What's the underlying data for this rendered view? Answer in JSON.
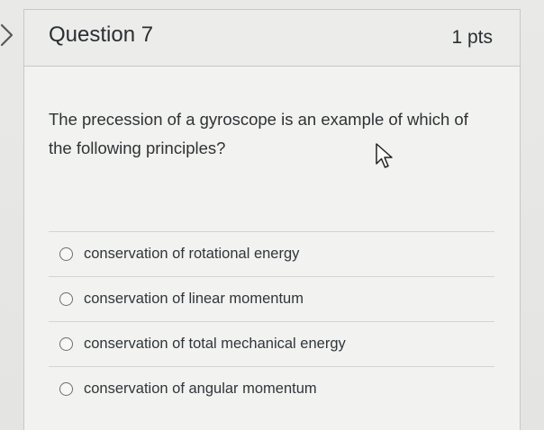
{
  "question": {
    "title": "Question 7",
    "points": "1 pts",
    "text": "The precession of a gyroscope is an example of which of the following principles?"
  },
  "answers": [
    {
      "label": "conservation of rotational energy",
      "selected": false
    },
    {
      "label": "conservation of linear momentum",
      "selected": false
    },
    {
      "label": "conservation of total mechanical energy",
      "selected": false
    },
    {
      "label": "conservation of angular momentum",
      "selected": false
    }
  ],
  "icons": {
    "nav": "chevron-right-icon",
    "cursor": "mouse-pointer-icon"
  }
}
